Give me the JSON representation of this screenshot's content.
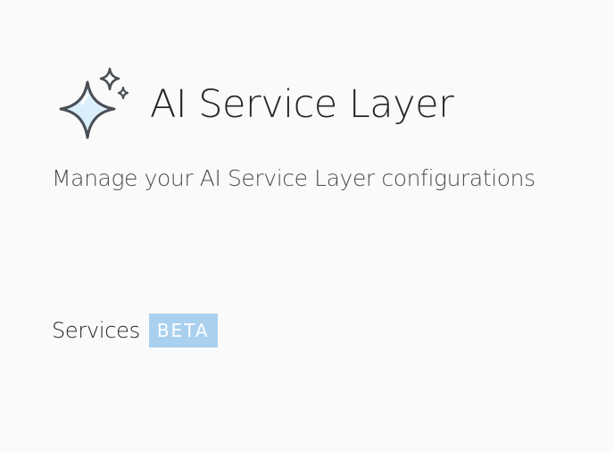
{
  "header": {
    "icon": "sparkle-icon",
    "title": "AI Service Layer"
  },
  "subtitle": "Manage your AI Service Layer configurations",
  "services_section": {
    "label": "Services",
    "badge": "BETA"
  },
  "colors": {
    "background": "#fafafa",
    "badge_bg": "#a9d0ef",
    "icon_fill": "#dbeefb",
    "icon_stroke": "#4a4f55"
  }
}
